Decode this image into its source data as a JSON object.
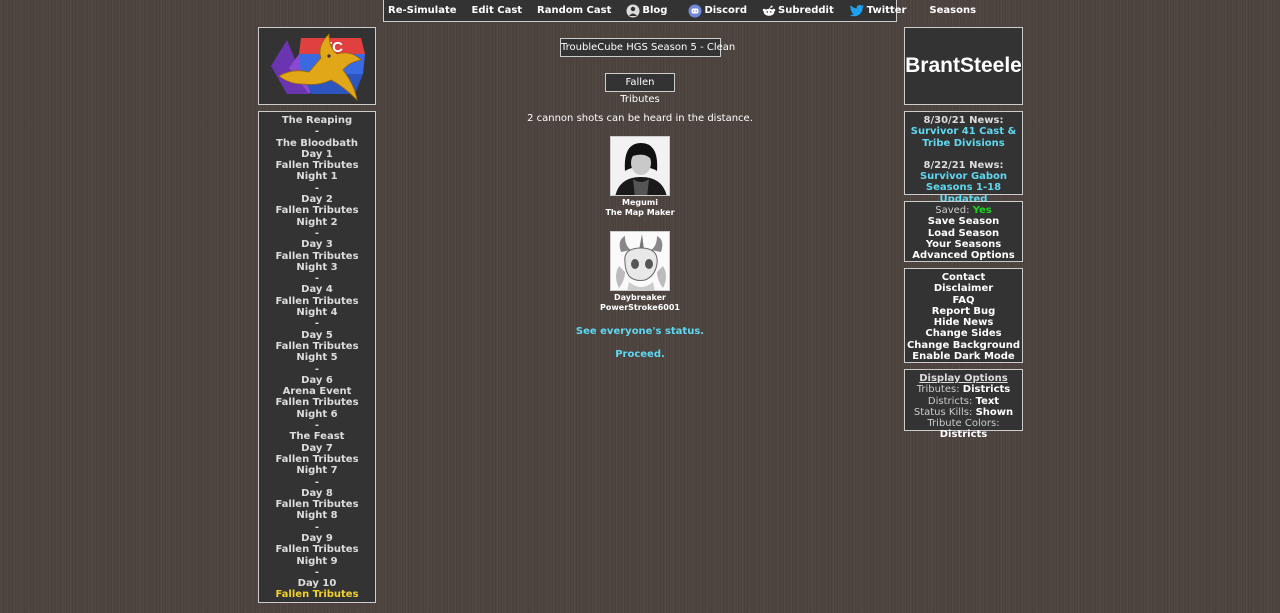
{
  "topnav": {
    "resim": "Re-Simulate",
    "edit": "Edit Cast",
    "random": "Random Cast",
    "blog": "Blog",
    "discord": "Discord",
    "subreddit": "Subreddit",
    "twitter": "Twitter",
    "seasons": "Seasons"
  },
  "left_nav": [
    "The Reaping",
    "-",
    "The Bloodbath",
    "Day 1",
    "Fallen Tributes",
    "Night 1",
    "-",
    "Day 2",
    "Fallen Tributes",
    "Night 2",
    "-",
    "Day 3",
    "Fallen Tributes",
    "Night 3",
    "-",
    "Day 4",
    "Fallen Tributes",
    "Night 4",
    "-",
    "Day 5",
    "Fallen Tributes",
    "Night 5",
    "-",
    "Day 6",
    "Arena Event",
    "Fallen Tributes",
    "Night 6",
    "-",
    "The Feast",
    "Day 7",
    "Fallen Tributes",
    "Night 7",
    "-",
    "Day 8",
    "Fallen Tributes",
    "Night 8",
    "-",
    "Day 9",
    "Fallen Tributes",
    "Night 9",
    "-",
    "Day 10",
    "Fallen Tributes"
  ],
  "left_nav_current_index": 42,
  "main": {
    "season_title": "TroubleCube HGS Season 5 - Clean",
    "phase_title": "Fallen Tributes",
    "cannon_text": "2 cannon shots can be heard in the distance.",
    "tributes": [
      {
        "name": "Megumi",
        "subtitle": "The Map Maker"
      },
      {
        "name": "Daybreaker",
        "subtitle": "PowerStroke6001"
      }
    ],
    "status_link": "See everyone's status.",
    "proceed_link": "Proceed."
  },
  "brand": "BrantSteele",
  "news": {
    "items": [
      {
        "date": "8/30/21 News:",
        "line1": "Survivor 41 Cast &",
        "line2": "Tribe Divisions"
      },
      {
        "date": "8/22/21 News:",
        "line1": "Survivor Gabon",
        "line2": "Seasons 1-18 Updated"
      }
    ]
  },
  "saved": {
    "label": "Saved:",
    "value": "Yes",
    "save": "Save Season",
    "load": "Load Season",
    "yours": "Your Seasons",
    "advanced": "Advanced Options"
  },
  "contact": {
    "contact": "Contact",
    "disclaimer": "Disclaimer",
    "faq": "FAQ",
    "report": "Report Bug",
    "hide": "Hide News",
    "sides": "Change Sides",
    "background": "Change Background",
    "dark": "Enable Dark Mode"
  },
  "display": {
    "heading": "Display Options",
    "tributes_label": "Tributes:",
    "tributes_value": "Districts",
    "districts_label": "Districts:",
    "districts_value": "Text",
    "kills_label": "Status Kills:",
    "kills_value": "Shown",
    "colors_label": "Tribute Colors:",
    "colors_value": "Districts"
  },
  "colors": {
    "link_cyan": "#5fd8f0",
    "current_yellow": "#f2d22a",
    "saved_green": "#1dd51d",
    "panel_bg": "#333333"
  },
  "icons": [
    "blog-icon",
    "discord-icon",
    "reddit-icon",
    "twitter-icon"
  ]
}
